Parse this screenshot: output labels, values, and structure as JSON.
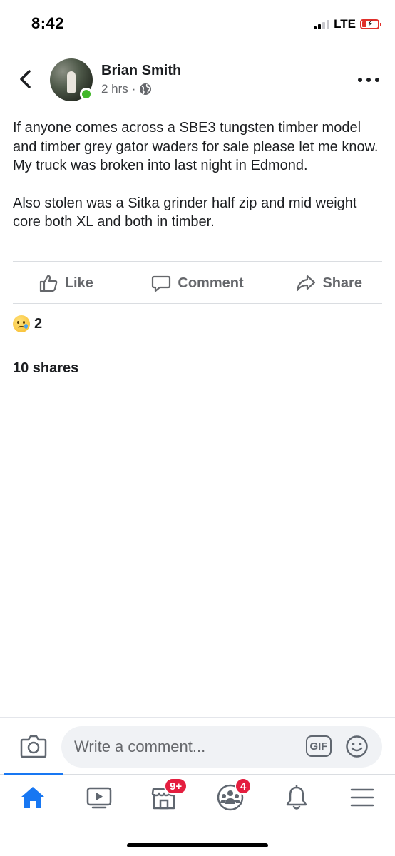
{
  "status_bar": {
    "time": "8:42",
    "network": "LTE",
    "battery_color": "#e0302b"
  },
  "post": {
    "author": "Brian Smith",
    "time": "2 hrs",
    "separator": "·",
    "privacy_icon": "globe-icon",
    "paragraphs": [
      "If anyone comes across a SBE3 tungsten timber model and timber grey gator waders for sale please let me know. My truck was broken into last night in Edmond.",
      "Also stolen was a Sitka grinder half zip and mid weight core both XL and both in timber."
    ]
  },
  "actions": {
    "like": "Like",
    "comment": "Comment",
    "share": "Share"
  },
  "reactions": {
    "icon": "sad-reaction-icon",
    "count": "2"
  },
  "shares_text": "10 shares",
  "composer": {
    "placeholder": "Write a comment...",
    "gif_label": "GIF"
  },
  "tab_bar": {
    "active_color": "#1877f2",
    "tabs": [
      {
        "name": "home-tab",
        "icon": "home-icon",
        "badge": ""
      },
      {
        "name": "watch-tab",
        "icon": "video-icon",
        "badge": ""
      },
      {
        "name": "marketplace-tab",
        "icon": "marketplace-icon",
        "badge": "9+"
      },
      {
        "name": "groups-tab",
        "icon": "groups-icon",
        "badge": "4"
      },
      {
        "name": "notifications-tab",
        "icon": "bell-icon",
        "badge": ""
      },
      {
        "name": "menu-tab",
        "icon": "menu-icon",
        "badge": ""
      }
    ]
  },
  "colors": {
    "text_primary": "#1c1e21",
    "text_secondary": "#65676b",
    "online": "#42b72a",
    "badge": "#e41e3f"
  }
}
